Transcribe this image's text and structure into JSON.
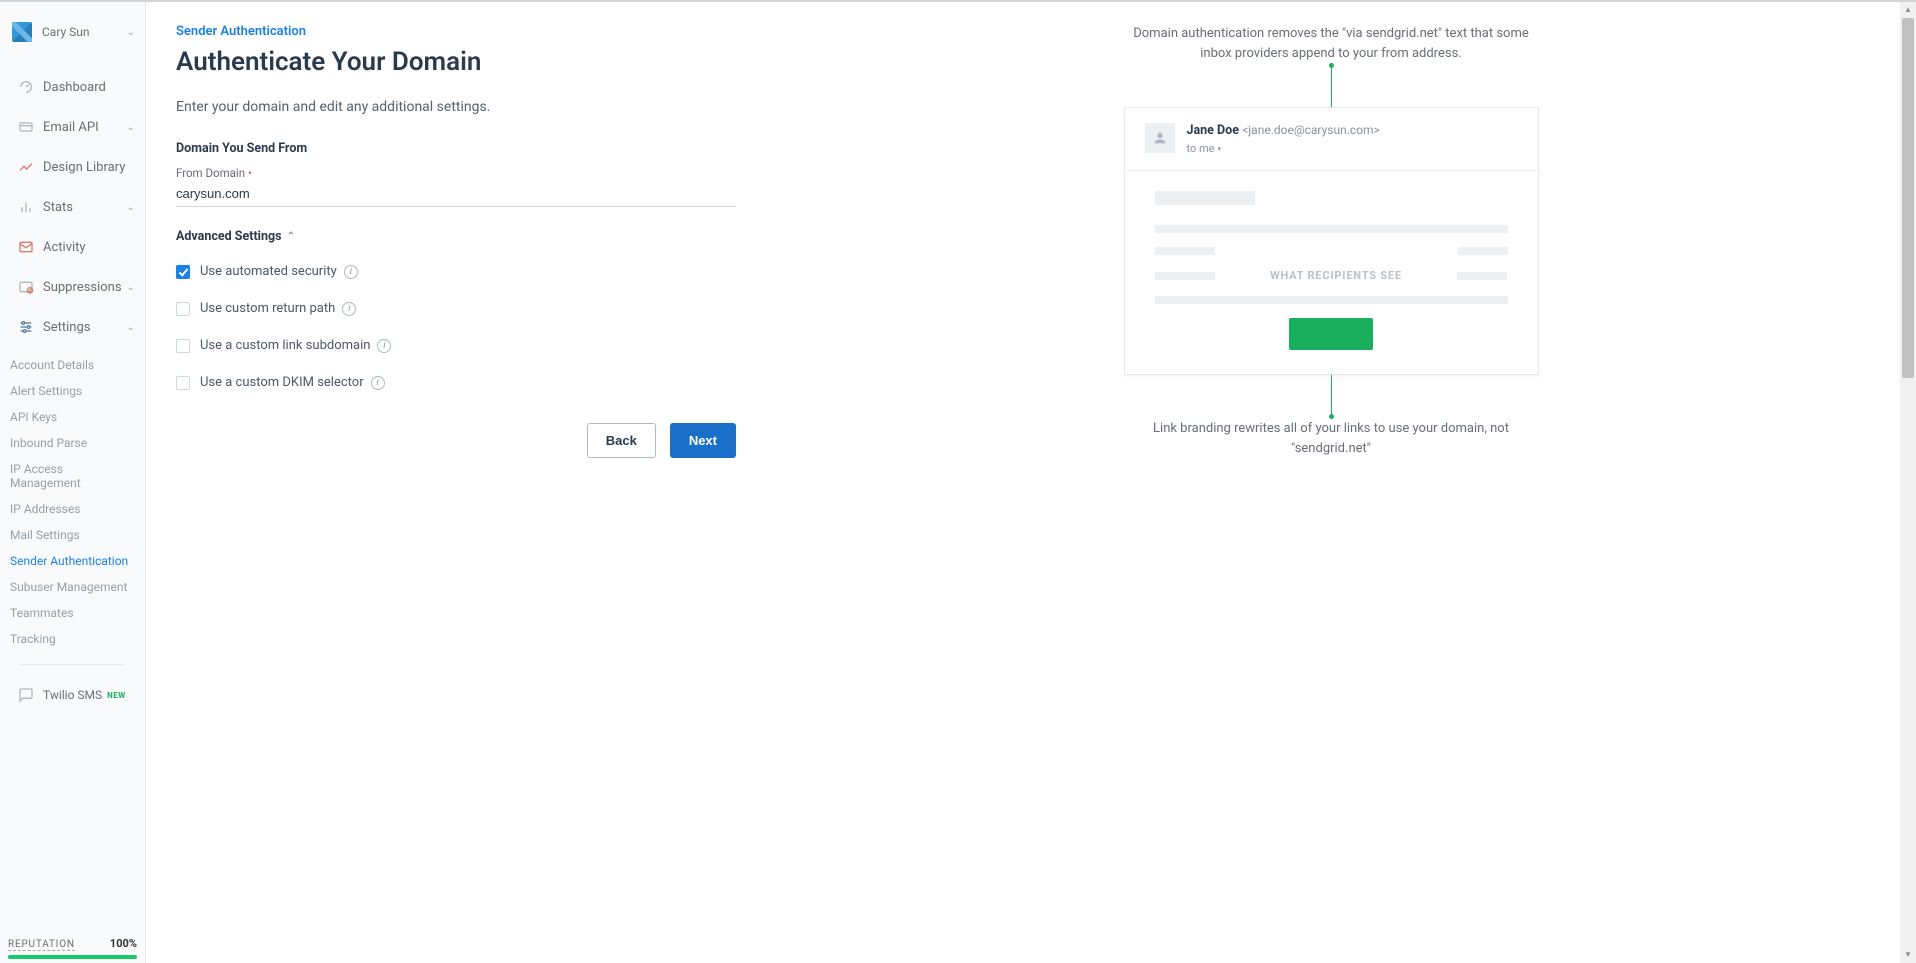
{
  "profile": {
    "name": "Cary Sun"
  },
  "nav": {
    "dashboard": "Dashboard",
    "email_api": "Email API",
    "design_library": "Design Library",
    "stats": "Stats",
    "activity": "Activity",
    "suppressions": "Suppressions",
    "settings": "Settings"
  },
  "settings_sub": {
    "account_details": "Account Details",
    "alert_settings": "Alert Settings",
    "api_keys": "API Keys",
    "inbound_parse": "Inbound Parse",
    "ip_access": "IP Access Management",
    "ip_addresses": "IP Addresses",
    "mail_settings": "Mail Settings",
    "sender_auth": "Sender Authentication",
    "subuser_mgmt": "Subuser Management",
    "teammates": "Teammates",
    "tracking": "Tracking"
  },
  "twilio": {
    "label": "Twilio SMS",
    "badge": "NEW"
  },
  "reputation": {
    "label": "REPUTATION",
    "value": "100%"
  },
  "page": {
    "breadcrumb": "Sender Authentication",
    "title": "Authenticate Your Domain",
    "subtitle": "Enter your domain and edit any additional settings.",
    "section_domain": "Domain You Send From",
    "from_domain_label": "From Domain",
    "from_domain_value": "carysun.com",
    "advanced": "Advanced Settings",
    "opt_auto_security": "Use automated security",
    "opt_custom_return": "Use custom return path",
    "opt_custom_link": "Use a custom link subdomain",
    "opt_custom_dkim": "Use a custom DKIM selector",
    "btn_back": "Back",
    "btn_next": "Next"
  },
  "preview": {
    "top_desc": "Domain authentication removes the \"via sendgrid.net\" text that some inbox providers append to your from address.",
    "from_name": "Jane Doe",
    "from_email": "<jane.doe@carysun.com>",
    "to_line": "to me",
    "recipients": "WHAT RECIPIENTS SEE",
    "bottom_desc": "Link branding rewrites all of your links to use your domain, not \"sendgrid.net\""
  }
}
